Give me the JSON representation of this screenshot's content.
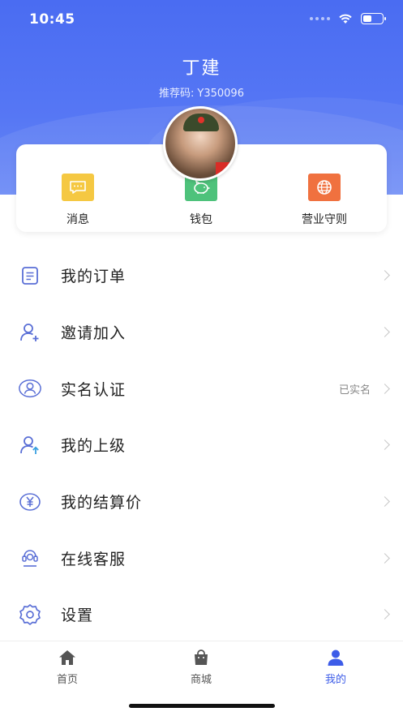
{
  "status": {
    "time": "10:45"
  },
  "profile": {
    "name": "丁建",
    "referral_label": "推荐码:",
    "referral_code": "Y350096"
  },
  "quick_actions": [
    {
      "label": "消息",
      "icon": "message-icon",
      "color": "#f5c842"
    },
    {
      "label": "钱包",
      "icon": "piggy-bank-icon",
      "color": "#4ec27b"
    },
    {
      "label": "营业守则",
      "icon": "globe-icon",
      "color": "#f0713f"
    }
  ],
  "menu": [
    {
      "label": "我的订单",
      "icon": "order-list-icon",
      "value": ""
    },
    {
      "label": "邀请加入",
      "icon": "invite-user-icon",
      "value": ""
    },
    {
      "label": "实名认证",
      "icon": "face-id-icon",
      "value": "已实名"
    },
    {
      "label": "我的上级",
      "icon": "superior-user-icon",
      "value": ""
    },
    {
      "label": "我的结算价",
      "icon": "yuan-icon",
      "value": ""
    },
    {
      "label": "在线客服",
      "icon": "customer-service-icon",
      "value": ""
    },
    {
      "label": "设置",
      "icon": "gear-icon",
      "value": ""
    }
  ],
  "tabs": [
    {
      "label": "首页",
      "icon": "home-icon",
      "active": false
    },
    {
      "label": "商城",
      "icon": "shopping-bag-icon",
      "active": false
    },
    {
      "label": "我的",
      "icon": "user-icon",
      "active": true
    }
  ],
  "colors": {
    "accent": "#3d5ce8",
    "header": "#4a6cf2"
  }
}
